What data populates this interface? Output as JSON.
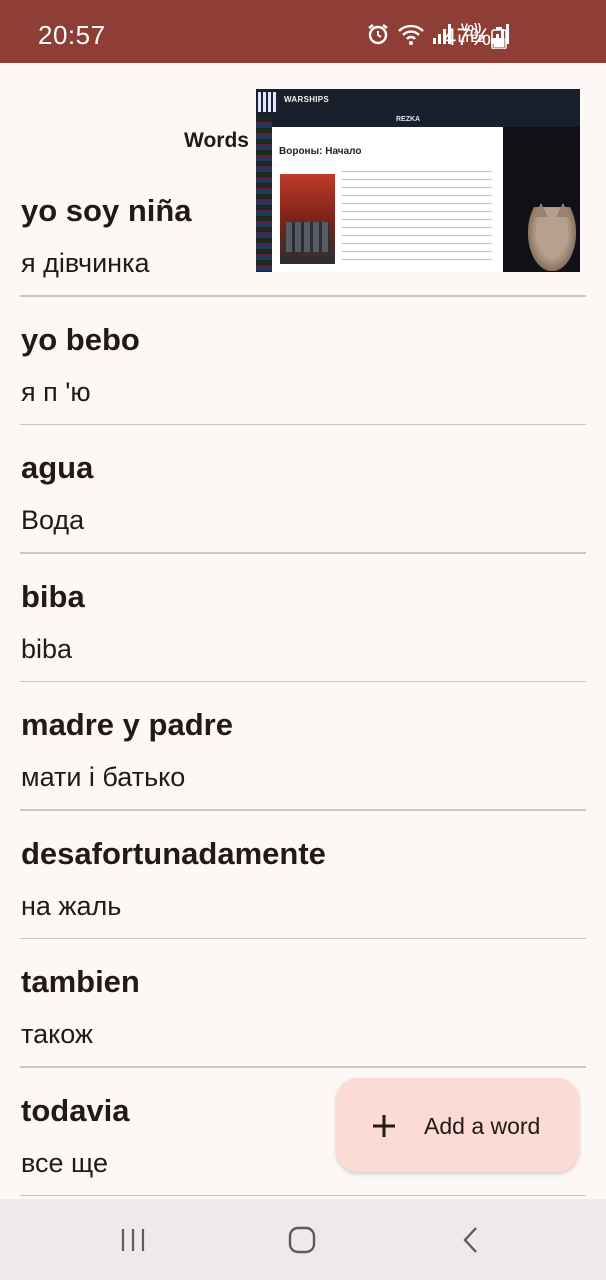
{
  "status_bar": {
    "time": "20:57",
    "network_label": "Vo)) LTE2",
    "battery": "47%"
  },
  "header": {
    "title": "Words"
  },
  "thumbnail": {
    "brand": "WARSHIPS",
    "site": "REZKA",
    "page_title": "Вороны: Начало"
  },
  "words": [
    {
      "term": "yo soy niña",
      "translation": "я дівчинка"
    },
    {
      "term": "yo bebo",
      "translation": "я п 'ю"
    },
    {
      "term": "agua",
      "translation": "Вода"
    },
    {
      "term": "biba",
      "translation": "biba"
    },
    {
      "term": "madre y padre",
      "translation": "мати і батько"
    },
    {
      "term": "desafortunadamente",
      "translation": "на жаль"
    },
    {
      "term": "tambien",
      "translation": "також"
    },
    {
      "term": "todavia",
      "translation": "все ще"
    }
  ],
  "fab": {
    "icon": "plus-icon",
    "label": "Add a word"
  },
  "navigation": {
    "recent": "recent-apps-icon",
    "home": "home-icon",
    "back": "back-icon"
  },
  "colors": {
    "status_bar": "#8f3e36",
    "background": "#fdf8f6",
    "fab": "#fcdbd4",
    "divider": "#d6c3c1"
  }
}
